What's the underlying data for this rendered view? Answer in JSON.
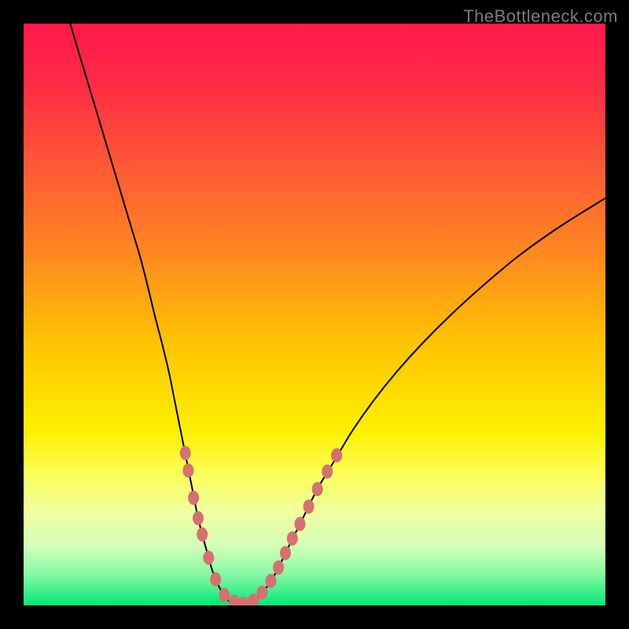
{
  "watermark": "TheBottleneck.com",
  "chart_data": {
    "type": "line",
    "title": "",
    "xlabel": "",
    "ylabel": "",
    "xlim": [
      0,
      1
    ],
    "ylim": [
      0,
      1
    ],
    "background_gradient": {
      "stops": [
        {
          "pos": 0.0,
          "color": "#ff1a4a"
        },
        {
          "pos": 0.1,
          "color": "#ff2a45"
        },
        {
          "pos": 0.25,
          "color": "#ff5a35"
        },
        {
          "pos": 0.4,
          "color": "#ff8a20"
        },
        {
          "pos": 0.55,
          "color": "#ffc400"
        },
        {
          "pos": 0.7,
          "color": "#fff000"
        },
        {
          "pos": 0.78,
          "color": "#faff60"
        },
        {
          "pos": 0.84,
          "color": "#f0ffa0"
        },
        {
          "pos": 0.9,
          "color": "#d0ffb8"
        },
        {
          "pos": 0.95,
          "color": "#80f8a0"
        },
        {
          "pos": 1.0,
          "color": "#00e878"
        }
      ]
    },
    "series": [
      {
        "name": "left-curve",
        "type": "line",
        "points": [
          {
            "x": 0.08,
            "y": 1.0
          },
          {
            "x": 0.095,
            "y": 0.95
          },
          {
            "x": 0.11,
            "y": 0.9
          },
          {
            "x": 0.125,
            "y": 0.85
          },
          {
            "x": 0.14,
            "y": 0.8
          },
          {
            "x": 0.155,
            "y": 0.75
          },
          {
            "x": 0.17,
            "y": 0.7
          },
          {
            "x": 0.185,
            "y": 0.65
          },
          {
            "x": 0.2,
            "y": 0.6
          },
          {
            "x": 0.213,
            "y": 0.55
          },
          {
            "x": 0.225,
            "y": 0.5
          },
          {
            "x": 0.238,
            "y": 0.45
          },
          {
            "x": 0.25,
            "y": 0.4
          },
          {
            "x": 0.26,
            "y": 0.35
          },
          {
            "x": 0.27,
            "y": 0.3
          },
          {
            "x": 0.28,
            "y": 0.25
          },
          {
            "x": 0.29,
            "y": 0.2
          },
          {
            "x": 0.3,
            "y": 0.15
          },
          {
            "x": 0.313,
            "y": 0.1
          },
          {
            "x": 0.328,
            "y": 0.05
          },
          {
            "x": 0.35,
            "y": 0.01
          },
          {
            "x": 0.375,
            "y": 0.002
          }
        ]
      },
      {
        "name": "right-curve",
        "type": "line",
        "points": [
          {
            "x": 0.375,
            "y": 0.002
          },
          {
            "x": 0.4,
            "y": 0.01
          },
          {
            "x": 0.43,
            "y": 0.05
          },
          {
            "x": 0.455,
            "y": 0.1
          },
          {
            "x": 0.48,
            "y": 0.15
          },
          {
            "x": 0.505,
            "y": 0.2
          },
          {
            "x": 0.535,
            "y": 0.25
          },
          {
            "x": 0.565,
            "y": 0.3
          },
          {
            "x": 0.6,
            "y": 0.35
          },
          {
            "x": 0.64,
            "y": 0.4
          },
          {
            "x": 0.685,
            "y": 0.45
          },
          {
            "x": 0.735,
            "y": 0.5
          },
          {
            "x": 0.79,
            "y": 0.55
          },
          {
            "x": 0.85,
            "y": 0.6
          },
          {
            "x": 0.92,
            "y": 0.65
          },
          {
            "x": 1.0,
            "y": 0.7
          }
        ]
      },
      {
        "name": "left-markers",
        "type": "scatter",
        "color": "#d77070",
        "points": [
          {
            "x": 0.278,
            "y": 0.262
          },
          {
            "x": 0.283,
            "y": 0.232
          },
          {
            "x": 0.292,
            "y": 0.185
          },
          {
            "x": 0.3,
            "y": 0.15
          },
          {
            "x": 0.307,
            "y": 0.122
          },
          {
            "x": 0.318,
            "y": 0.082
          },
          {
            "x": 0.33,
            "y": 0.045
          },
          {
            "x": 0.345,
            "y": 0.018
          },
          {
            "x": 0.362,
            "y": 0.006
          },
          {
            "x": 0.378,
            "y": 0.003
          }
        ]
      },
      {
        "name": "right-markers",
        "type": "scatter",
        "color": "#d77070",
        "points": [
          {
            "x": 0.395,
            "y": 0.008
          },
          {
            "x": 0.41,
            "y": 0.022
          },
          {
            "x": 0.425,
            "y": 0.042
          },
          {
            "x": 0.438,
            "y": 0.065
          },
          {
            "x": 0.45,
            "y": 0.09
          },
          {
            "x": 0.462,
            "y": 0.115
          },
          {
            "x": 0.475,
            "y": 0.14
          },
          {
            "x": 0.49,
            "y": 0.17
          },
          {
            "x": 0.505,
            "y": 0.2
          },
          {
            "x": 0.522,
            "y": 0.23
          },
          {
            "x": 0.538,
            "y": 0.258
          }
        ]
      }
    ]
  }
}
